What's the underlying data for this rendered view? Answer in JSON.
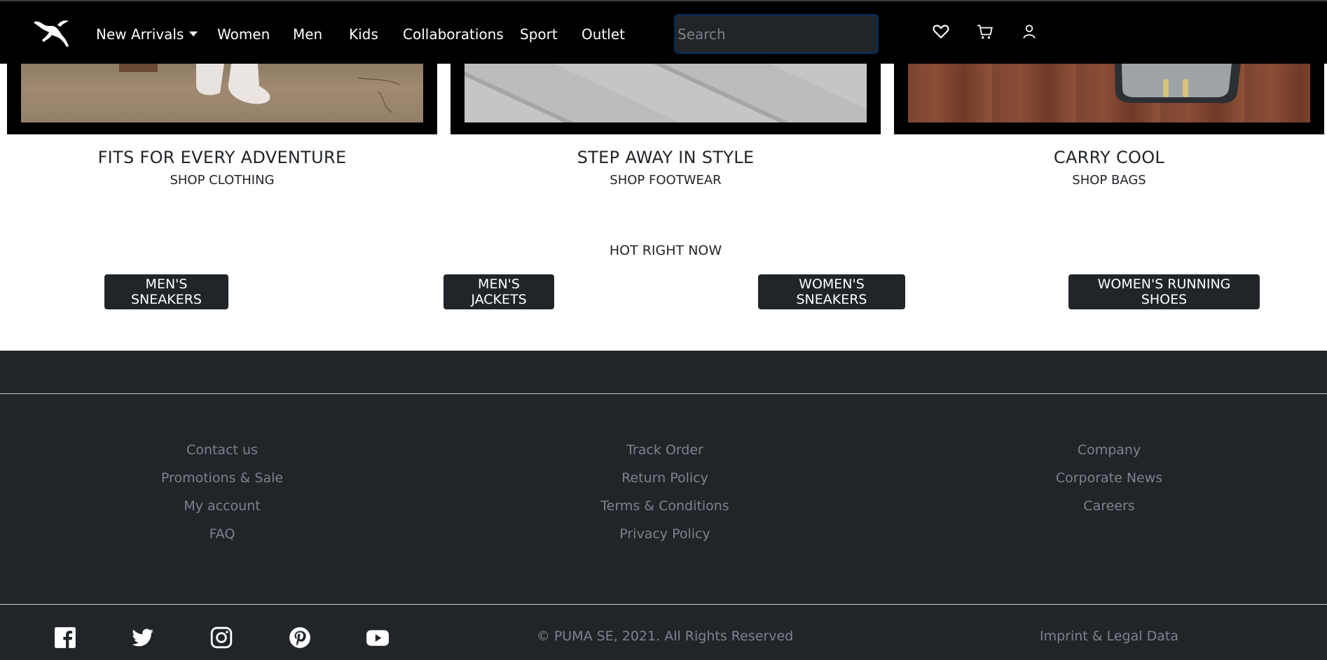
{
  "nav": {
    "logo": "puma-logo",
    "links": [
      "New Arrivals",
      "Women",
      "Men",
      "Kids",
      "Collaborations",
      "Sport",
      "Outlet"
    ],
    "search_placeholder": "Search",
    "icons": [
      "heart-icon",
      "cart-icon",
      "user-icon"
    ]
  },
  "tiles": [
    {
      "title": "FITS FOR EVERY ADVENTURE",
      "subtitle": "SHOP CLOTHING"
    },
    {
      "title": "STEP AWAY IN STYLE",
      "subtitle": "SHOP FOOTWEAR"
    },
    {
      "title": "CARRY COOL",
      "subtitle": "SHOP BAGS"
    }
  ],
  "hot": {
    "title": "HOT RIGHT NOW",
    "buttons": [
      "MEN'S SNEAKERS",
      "MEN'S JACKETS",
      "WOMEN'S SNEAKERS",
      "WOMEN'S RUNNING SHOES"
    ]
  },
  "footer": {
    "columns": [
      [
        "Contact us",
        "Promotions & Sale",
        "My account",
        "FAQ"
      ],
      [
        "Track Order",
        "Return Policy",
        "Terms & Conditions",
        "Privacy Policy"
      ],
      [
        "Company",
        "Corporate News",
        "Careers"
      ]
    ],
    "social_icons": [
      "facebook-icon",
      "twitter-icon",
      "instagram-icon",
      "pinterest-icon",
      "youtube-icon"
    ],
    "copyright": "© PUMA SE, 2021. All Rights Reserved",
    "imprint": "Imprint & Legal Data"
  },
  "colors": {
    "nav_bg": "#000000",
    "footer_bg": "#212529",
    "button_bg": "#212529",
    "footer_text": "#7d838b"
  }
}
